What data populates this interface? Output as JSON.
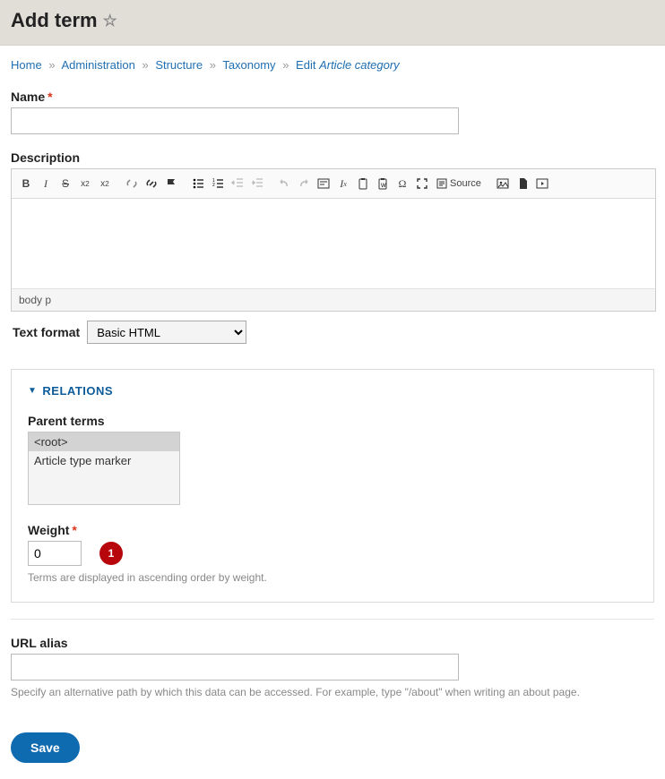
{
  "page": {
    "title": "Add term"
  },
  "breadcrumb": {
    "home": "Home",
    "admin": "Administration",
    "structure": "Structure",
    "taxonomy": "Taxonomy",
    "edit_prefix": "Edit ",
    "edit_em": "Article category"
  },
  "name": {
    "label": "Name",
    "value": ""
  },
  "description": {
    "label": "Description",
    "status": "body   p",
    "toolbar": {
      "source_label": "Source"
    }
  },
  "textformat": {
    "label": "Text format",
    "selected": "Basic HTML",
    "options": [
      "Basic HTML"
    ]
  },
  "relations": {
    "title": "RELATIONS",
    "parent_label": "Parent terms",
    "options": [
      "<root>",
      "Article type marker"
    ],
    "selected_index": 0,
    "weight_label": "Weight",
    "weight_value": "0",
    "weight_hint": "Terms are displayed in ascending order by weight."
  },
  "annotation": {
    "num": "1"
  },
  "url": {
    "label": "URL alias",
    "value": "",
    "hint": "Specify an alternative path by which this data can be accessed. For example, type \"/about\" when writing an about page."
  },
  "actions": {
    "save": "Save"
  }
}
